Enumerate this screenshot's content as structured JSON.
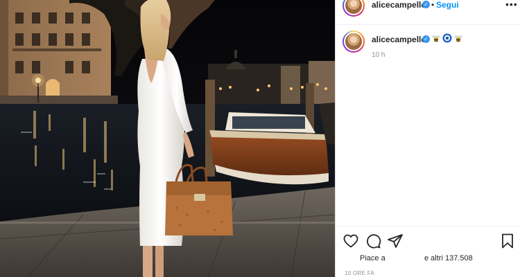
{
  "post": {
    "username": "alicecampello",
    "verified": true,
    "follow_label": "Segui",
    "follow_separator": "•",
    "more_label": "•••"
  },
  "caption": {
    "username": "alicecampello",
    "emojis": [
      "bee-emoji",
      "nazar-amulet-emoji",
      "bee-emoji"
    ],
    "relative_time": "10 h"
  },
  "actions": {
    "like_icon": "heart-icon",
    "comment_icon": "comment-icon",
    "share_icon": "paper-plane-icon",
    "save_icon": "bookmark-icon"
  },
  "likes": {
    "prefix": "Piace a",
    "suffix": "e altri 137.508"
  },
  "timestamp": "10 ORE FA",
  "colors": {
    "follow_blue": "#0095f6",
    "verified_blue": "#3897f0",
    "text": "#262626",
    "muted": "#8e8e8e"
  }
}
